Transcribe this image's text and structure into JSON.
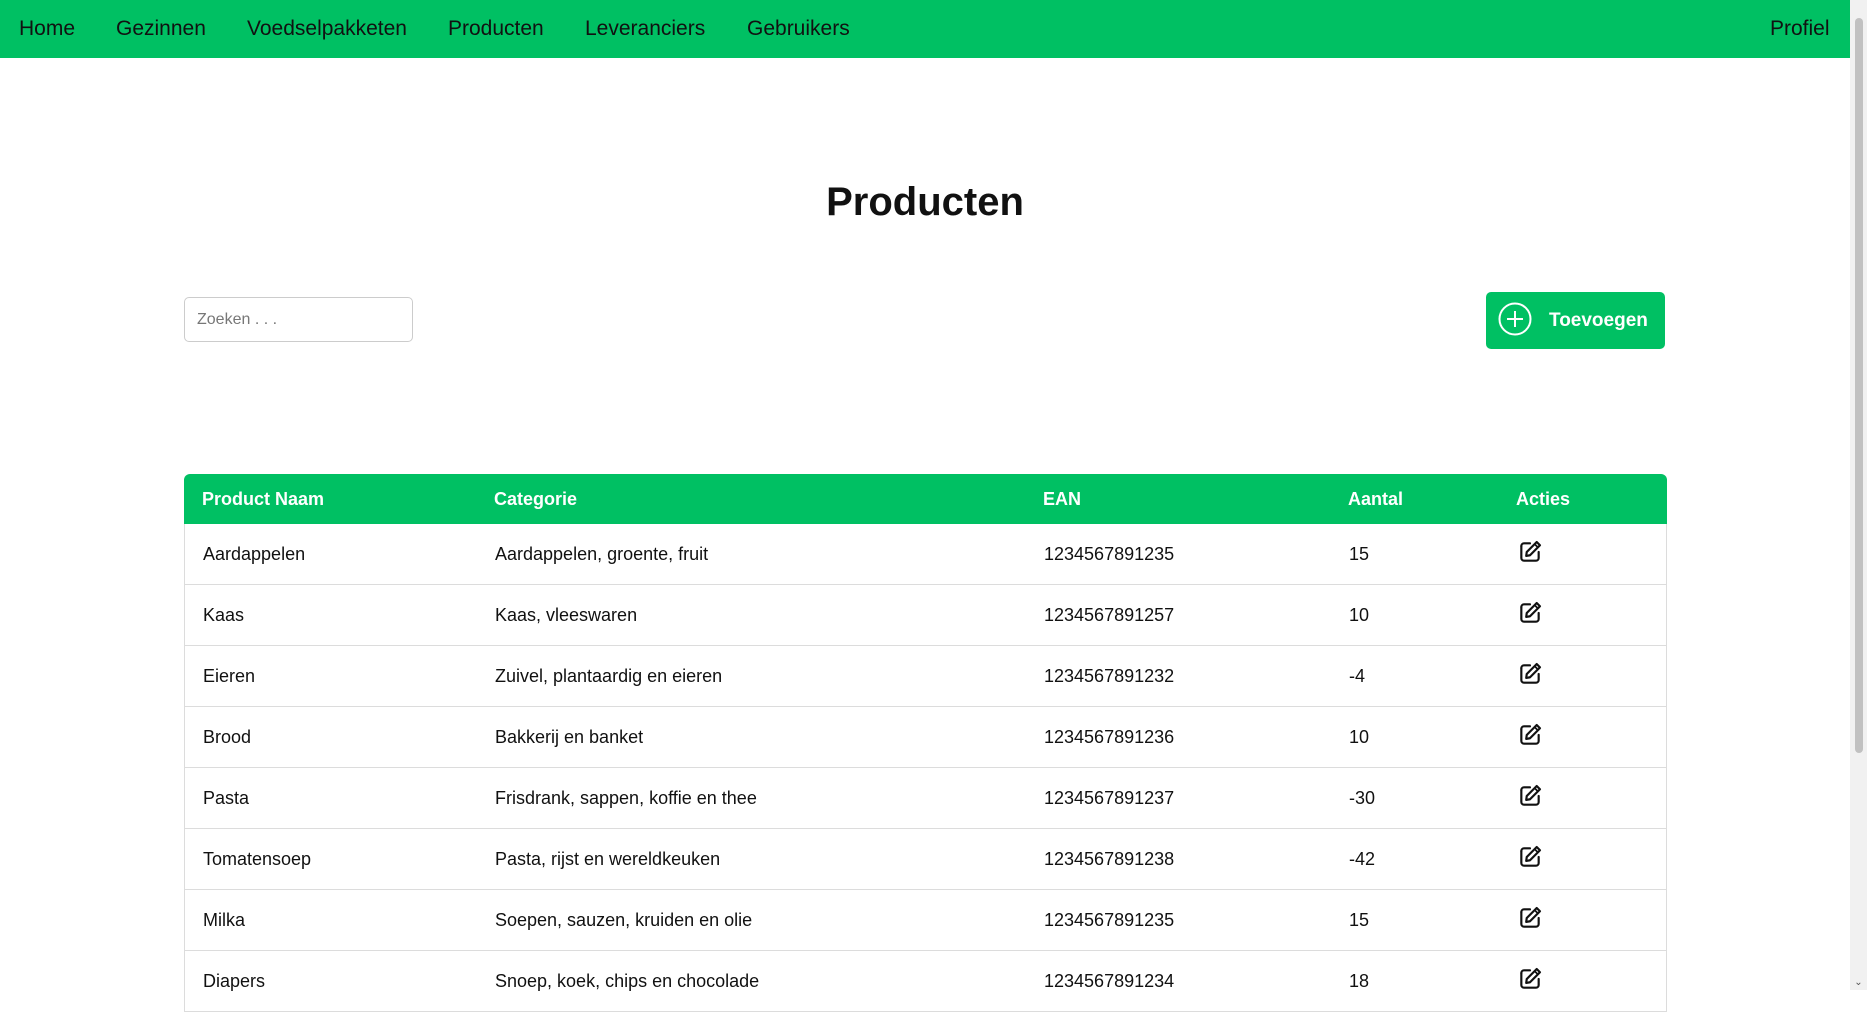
{
  "colors": {
    "brand": "#00c063",
    "text": "#111111"
  },
  "nav": {
    "items": [
      {
        "label": "Home"
      },
      {
        "label": "Gezinnen"
      },
      {
        "label": "Voedselpakketen"
      },
      {
        "label": "Producten"
      },
      {
        "label": "Leveranciers"
      },
      {
        "label": "Gebruikers"
      }
    ],
    "profile": "Profiel"
  },
  "page": {
    "title": "Producten"
  },
  "search": {
    "placeholder": "Zoeken . . ."
  },
  "add_button": {
    "label": "Toevoegen",
    "icon": "plus-circle-icon"
  },
  "table": {
    "columns": [
      "Product Naam",
      "Categorie",
      "EAN",
      "Aantal",
      "Acties"
    ],
    "action_icon": "edit-icon",
    "rows": [
      {
        "name": "Aardappelen",
        "category": "Aardappelen, groente, fruit",
        "ean": "1234567891235",
        "amount": "15"
      },
      {
        "name": "Kaas",
        "category": "Kaas, vleeswaren",
        "ean": "1234567891257",
        "amount": "10"
      },
      {
        "name": "Eieren",
        "category": "Zuivel, plantaardig en eieren",
        "ean": "1234567891232",
        "amount": "-4"
      },
      {
        "name": "Brood",
        "category": "Bakkerij en banket",
        "ean": "1234567891236",
        "amount": "10"
      },
      {
        "name": "Pasta",
        "category": "Frisdrank, sappen, koffie en thee",
        "ean": "1234567891237",
        "amount": "-30"
      },
      {
        "name": "Tomatensoep",
        "category": "Pasta, rijst en wereldkeuken",
        "ean": "1234567891238",
        "amount": "-42"
      },
      {
        "name": "Milka",
        "category": "Soepen, sauzen, kruiden en olie",
        "ean": "1234567891235",
        "amount": "15"
      },
      {
        "name": "Diapers",
        "category": "Snoep, koek, chips en chocolade",
        "ean": "1234567891234",
        "amount": "18"
      }
    ]
  }
}
